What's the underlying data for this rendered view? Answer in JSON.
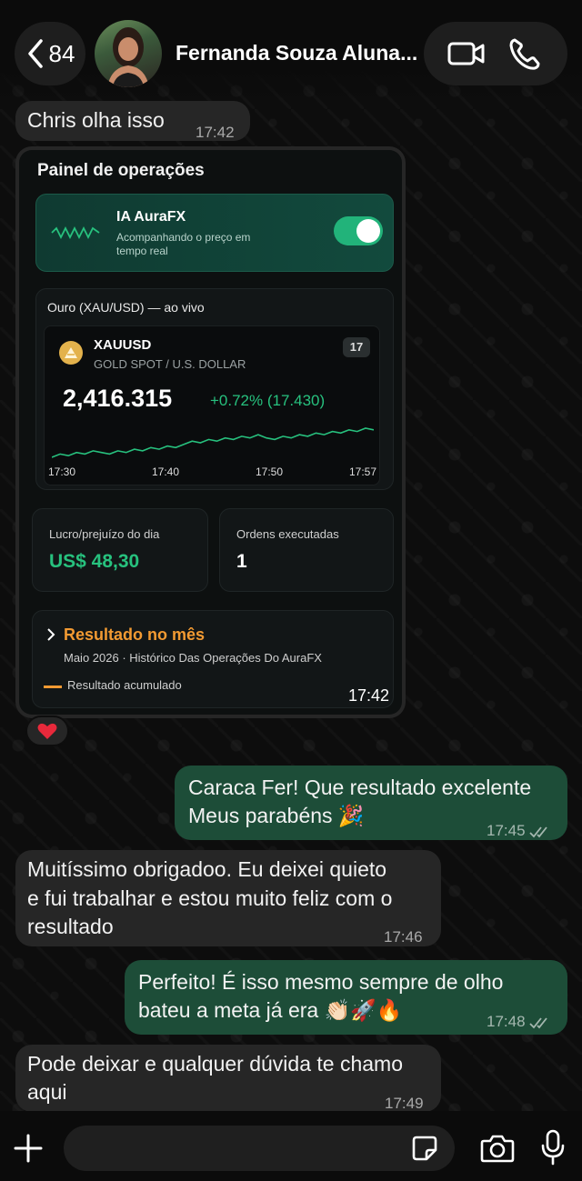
{
  "header": {
    "back_count": "84",
    "contact_name": "Fernanda Souza Aluna...",
    "icons": [
      "chevron-left-icon",
      "video-call-icon",
      "phone-icon"
    ]
  },
  "messages": [
    {
      "direction": "in",
      "text": "Chris olha isso",
      "time": "17:42"
    },
    {
      "direction": "in",
      "type": "image",
      "time": "17:42",
      "reaction": "❤️"
    },
    {
      "direction": "out",
      "line1": "Caraca Fer!  Que resultado excelente",
      "line2": "Meus parabéns 🎉",
      "time": "17:45"
    },
    {
      "direction": "in",
      "line1": "Muitíssimo obrigadoo.  Eu deixei quieto",
      "line2": "e fui trabalhar  e estou muito feliz com o",
      "line3": "resultado",
      "time": "17:46"
    },
    {
      "direction": "out",
      "line1": "Perfeito! É isso mesmo  sempre de olho",
      "line2": "bateu a meta  já era 👏🏻🚀🔥",
      "time": "17:48"
    },
    {
      "direction": "in",
      "line1": "Pode deixar e qualquer dúvida te chamo",
      "line2": "aqui",
      "time": "17:49"
    }
  ],
  "panel": {
    "title": "Painel de operações",
    "ai": {
      "name": "IA AuraFX",
      "desc": "Acompanhando o preço em tempo real",
      "toggle_on": true
    },
    "chart_card_title": "Ouro (XAU/USD) — ao vivo",
    "symbol": "XAUUSD",
    "symbol_desc": "GOLD SPOT / U.S. DOLLAR",
    "tv_badge": "17",
    "price": "2,416.315",
    "change": "+0.72% (17.430)",
    "stats": [
      {
        "label": "Lucro/prejuízo do dia",
        "value": "US$ 48,30",
        "color": "#27c17e"
      },
      {
        "label": "Ordens executadas",
        "value": "1",
        "color": "#ffffff"
      }
    ],
    "result": {
      "title": "Resultado no mês",
      "subtitle": "Maio 2026 · Histórico Das Operações Do AuraFX",
      "legend": "Resultado acumulado"
    }
  },
  "chart_data": {
    "type": "line",
    "x_ticks": [
      "17:30",
      "17:40",
      "17:50",
      "17:57"
    ],
    "values": [
      12,
      14,
      13,
      15,
      14,
      16,
      15,
      14,
      16,
      15,
      17,
      16,
      18,
      17,
      19,
      18,
      20,
      22,
      21,
      23,
      22,
      24,
      23,
      25,
      24,
      26,
      24,
      23,
      25,
      24,
      26,
      25,
      27,
      26,
      28,
      27,
      29,
      28,
      30,
      29
    ],
    "color": "#27c17e"
  },
  "input": {
    "placeholder": ""
  },
  "colors": {
    "outgoing": "#1d4d38",
    "incoming": "#262626",
    "accent": "#27c17e",
    "orange": "#f29a32"
  }
}
